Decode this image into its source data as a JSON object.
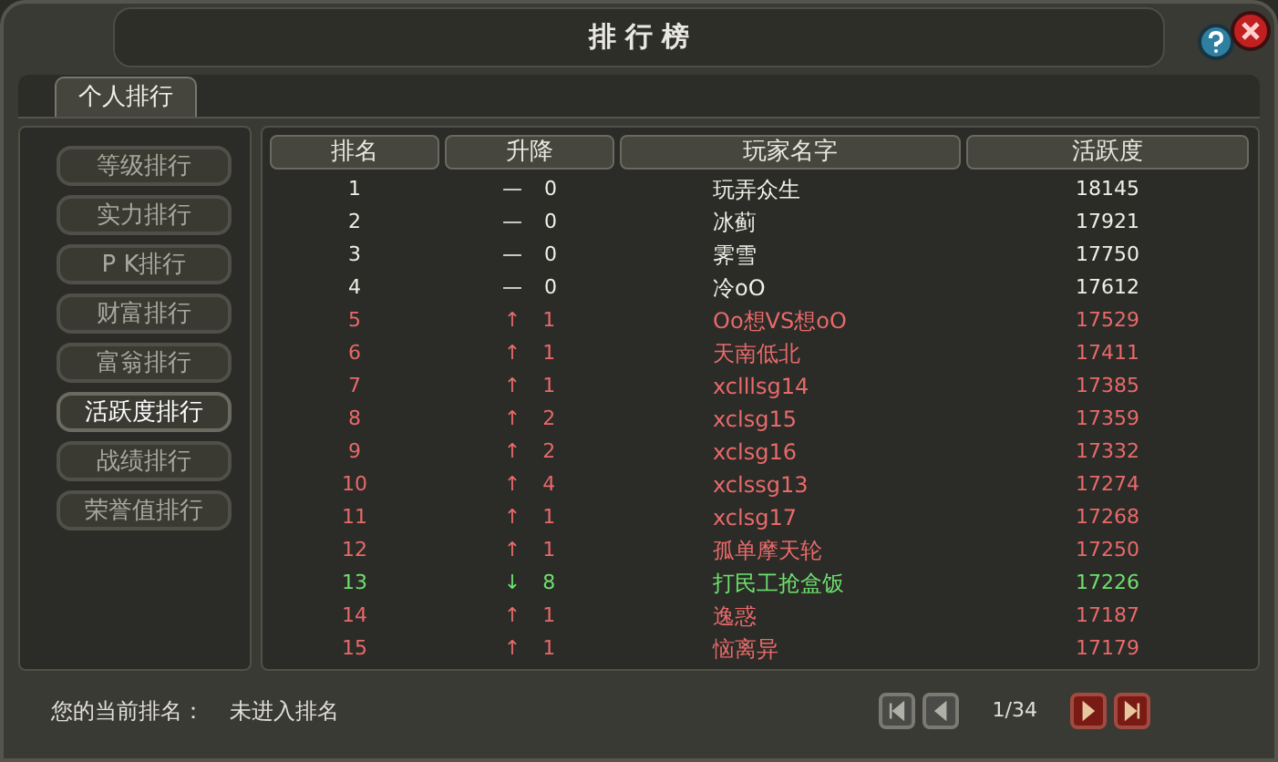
{
  "window": {
    "title": "排 行 榜"
  },
  "tabs": [
    {
      "label": "个人排行",
      "selected": true
    }
  ],
  "sidebar": {
    "items": [
      {
        "label": "等级排行",
        "selected": false
      },
      {
        "label": "实力排行",
        "selected": false
      },
      {
        "label": "P K排行",
        "selected": false
      },
      {
        "label": "财富排行",
        "selected": false
      },
      {
        "label": "富翁排行",
        "selected": false
      },
      {
        "label": "活跃度排行",
        "selected": true
      },
      {
        "label": "战绩排行",
        "selected": false
      },
      {
        "label": "荣誉值排行",
        "selected": false
      }
    ]
  },
  "table": {
    "columns": [
      "排名",
      "升降",
      "玩家名字",
      "活跃度"
    ],
    "rows": [
      {
        "rank": "1",
        "kind": "same",
        "arrow": "—",
        "change": "0",
        "name": "玩弄众生",
        "score": "18145"
      },
      {
        "rank": "2",
        "kind": "same",
        "arrow": "—",
        "change": "0",
        "name": "冰蓟",
        "score": "17921"
      },
      {
        "rank": "3",
        "kind": "same",
        "arrow": "—",
        "change": "0",
        "name": "霁雪",
        "score": "17750"
      },
      {
        "rank": "4",
        "kind": "same",
        "arrow": "—",
        "change": "0",
        "name": "冷oO",
        "score": "17612"
      },
      {
        "rank": "5",
        "kind": "up",
        "arrow": "↑",
        "change": "1",
        "name": "Oo想VS想oO",
        "score": "17529"
      },
      {
        "rank": "6",
        "kind": "up",
        "arrow": "↑",
        "change": "1",
        "name": "天南低北",
        "score": "17411"
      },
      {
        "rank": "7",
        "kind": "up",
        "arrow": "↑",
        "change": "1",
        "name": "xclllsg14",
        "score": "17385"
      },
      {
        "rank": "8",
        "kind": "up",
        "arrow": "↑",
        "change": "2",
        "name": "xclsg15",
        "score": "17359"
      },
      {
        "rank": "9",
        "kind": "up",
        "arrow": "↑",
        "change": "2",
        "name": "xclsg16",
        "score": "17332"
      },
      {
        "rank": "10",
        "kind": "up",
        "arrow": "↑",
        "change": "4",
        "name": "xclssg13",
        "score": "17274"
      },
      {
        "rank": "11",
        "kind": "up",
        "arrow": "↑",
        "change": "1",
        "name": "xclsg17",
        "score": "17268"
      },
      {
        "rank": "12",
        "kind": "up",
        "arrow": "↑",
        "change": "1",
        "name": "孤单摩天轮",
        "score": "17250"
      },
      {
        "rank": "13",
        "kind": "down",
        "arrow": "↓",
        "change": "8",
        "name": "打民工抢盒饭",
        "score": "17226"
      },
      {
        "rank": "14",
        "kind": "up",
        "arrow": "↑",
        "change": "1",
        "name": "逸惑",
        "score": "17187"
      },
      {
        "rank": "15",
        "kind": "up",
        "arrow": "↑",
        "change": "1",
        "name": "恼离异",
        "score": "17179"
      }
    ]
  },
  "footer": {
    "label": "您的当前排名：",
    "value": "未进入排名"
  },
  "pager": {
    "page": "1/34",
    "buttons": [
      {
        "kind": "first",
        "disabled": true
      },
      {
        "kind": "prev",
        "disabled": true
      },
      {
        "kind": "next",
        "disabled": false
      },
      {
        "kind": "last",
        "disabled": false
      }
    ]
  }
}
